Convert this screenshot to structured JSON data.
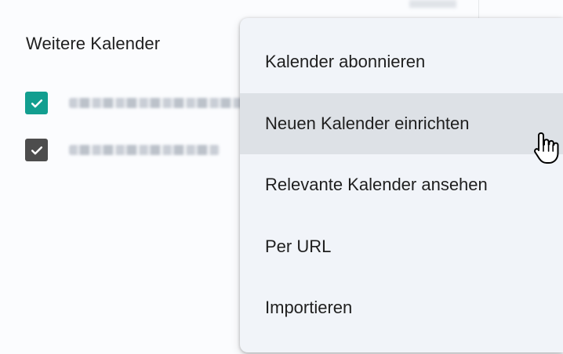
{
  "sidebar": {
    "section_title": "Weitere Kalender",
    "calendars": [
      {
        "checked": true,
        "color": "#129e8f",
        "name": "(blurred)"
      },
      {
        "checked": true,
        "color": "#4d4d4d",
        "name": "(blurred)"
      }
    ]
  },
  "context_menu": {
    "items": [
      {
        "label": "Kalender abonnieren"
      },
      {
        "label": "Neuen Kalender einrichten",
        "hovered": true
      },
      {
        "label": "Relevante Kalender ansehen"
      },
      {
        "label": "Per URL"
      },
      {
        "label": "Importieren"
      }
    ]
  },
  "colors": {
    "menu_bg": "#f1f4f9",
    "menu_hover": "#dde1e6",
    "text": "#1f1f1f"
  },
  "icons": {
    "checkbox": "check-icon",
    "pointer": "hand-cursor-icon"
  }
}
